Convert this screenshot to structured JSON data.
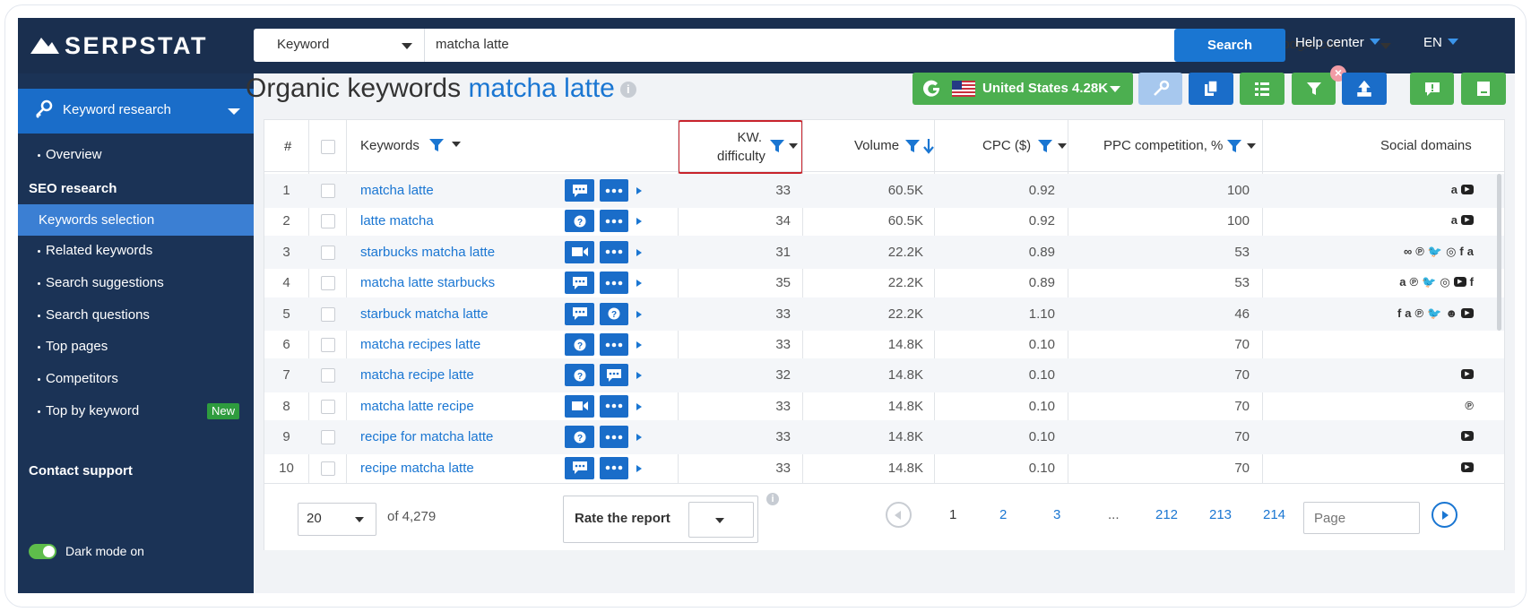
{
  "brand": {
    "name": "SERPSTAT"
  },
  "search": {
    "type": "Keyword",
    "query": "matcha latte",
    "engine": "google.com",
    "button": "Search"
  },
  "header": {
    "help": "Help center",
    "lang": "EN"
  },
  "sidebar": {
    "module": "Keyword research",
    "items": [
      {
        "label": "Overview"
      },
      {
        "label": "SEO research"
      },
      {
        "label": "Keywords selection"
      },
      {
        "label": "Related keywords"
      },
      {
        "label": "Search suggestions"
      },
      {
        "label": "Search questions"
      },
      {
        "label": "Top pages"
      },
      {
        "label": "Competitors"
      },
      {
        "label": "Top by keyword",
        "badge": "New"
      }
    ],
    "contact": "Contact support",
    "dark_mode": "Dark mode on"
  },
  "page": {
    "title": "Organic keywords",
    "keyword": "matcha latte",
    "country": "United States 4.28K"
  },
  "table": {
    "headers": {
      "num": "#",
      "keywords": "Keywords",
      "kd_line1": "KW.",
      "kd_line2": "difficulty",
      "volume": "Volume",
      "cpc": "CPC ($)",
      "ppc": "PPC competition, %",
      "social": "Social domains"
    },
    "rows": [
      {
        "n": "1",
        "kw": "matcha latte",
        "kd": "33",
        "vol": "60.5K",
        "cpc": "0.92",
        "ppc": "100"
      },
      {
        "n": "2",
        "kw": "latte matcha",
        "kd": "34",
        "vol": "60.5K",
        "cpc": "0.92",
        "ppc": "100"
      },
      {
        "n": "3",
        "kw": "starbucks matcha latte",
        "kd": "31",
        "vol": "22.2K",
        "cpc": "0.89",
        "ppc": "53"
      },
      {
        "n": "4",
        "kw": "matcha latte starbucks",
        "kd": "35",
        "vol": "22.2K",
        "cpc": "0.89",
        "ppc": "53"
      },
      {
        "n": "5",
        "kw": "starbuck matcha latte",
        "kd": "33",
        "vol": "22.2K",
        "cpc": "1.10",
        "ppc": "46"
      },
      {
        "n": "6",
        "kw": "matcha recipes latte",
        "kd": "33",
        "vol": "14.8K",
        "cpc": "0.10",
        "ppc": "70"
      },
      {
        "n": "7",
        "kw": "matcha recipe latte",
        "kd": "32",
        "vol": "14.8K",
        "cpc": "0.10",
        "ppc": "70"
      },
      {
        "n": "8",
        "kw": "matcha latte recipe",
        "kd": "33",
        "vol": "14.8K",
        "cpc": "0.10",
        "ppc": "70"
      },
      {
        "n": "9",
        "kw": "recipe for matcha latte",
        "kd": "33",
        "vol": "14.8K",
        "cpc": "0.10",
        "ppc": "70"
      },
      {
        "n": "10",
        "kw": "recipe matcha latte",
        "kd": "33",
        "vol": "14.8K",
        "cpc": "0.10",
        "ppc": "70"
      }
    ]
  },
  "footer": {
    "per_page": "20",
    "total": "of 4,279",
    "rate": "Rate the report",
    "pages": [
      "1",
      "2",
      "3",
      "...",
      "212",
      "213",
      "214"
    ],
    "page_placeholder": "Page"
  }
}
